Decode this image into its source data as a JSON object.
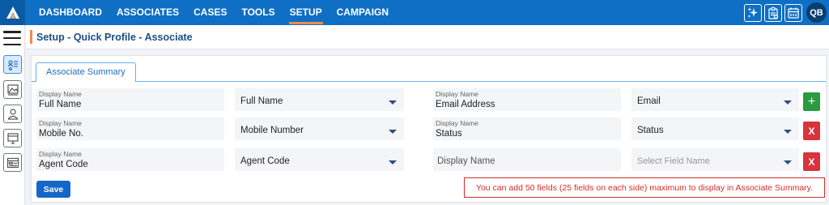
{
  "topbar": {
    "nav": [
      {
        "label": "DASHBOARD"
      },
      {
        "label": "ASSOCIATES"
      },
      {
        "label": "CASES"
      },
      {
        "label": "TOOLS"
      },
      {
        "label": "SETUP",
        "active": true
      },
      {
        "label": "CAMPAIGN"
      }
    ],
    "user_initials": "QB",
    "icons": [
      "app-logo-icon",
      "sparkle-icon",
      "clipboard-icon",
      "calendar-icon"
    ]
  },
  "sidebar": {
    "icons": [
      "menu-icon",
      "profile-list-icon",
      "image-card-icon",
      "user-icon",
      "monitor-icon",
      "form-icon"
    ]
  },
  "header": {
    "title": "Setup - Quick Profile - Associate"
  },
  "panel": {
    "tab_label": "Associate Summary",
    "left_rows": [
      {
        "display_label": "Display Name",
        "display_value": "Full Name",
        "field_select": "Full Name"
      },
      {
        "display_label": "Display Name",
        "display_value": "Mobile No.",
        "field_select": "Mobile Number"
      },
      {
        "display_label": "Display Name",
        "display_value": "Agent Code",
        "field_select": "Agent Code"
      }
    ],
    "right_rows": [
      {
        "display_label": "Display Name",
        "display_value": "Email Address",
        "field_select": "Email",
        "action": "+"
      },
      {
        "display_label": "Display Name",
        "display_value": "Status",
        "field_select": "Status",
        "action": "X"
      },
      {
        "display_placeholder": "Display Name",
        "field_placeholder": "Select Field Name",
        "action": "X"
      }
    ],
    "save_label": "Save",
    "note": "You can add 50 fields (25 fields on each side) maximum to display in Associate Summary."
  },
  "colors": {
    "topbar": "#0e6fc5",
    "accent": "#f08a4b",
    "title": "#1e4e82",
    "add_button": "#2a9b3f",
    "delete_button": "#d9343c",
    "save_button": "#1467c9",
    "warning": "#d52b2b"
  }
}
